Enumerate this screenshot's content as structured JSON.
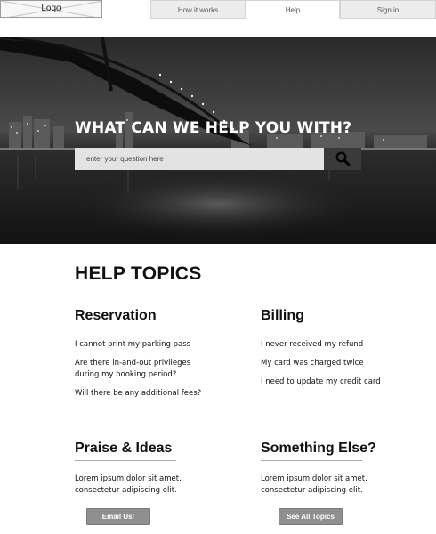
{
  "header": {
    "logo_text": "Logo",
    "nav": [
      {
        "label": "How it works"
      },
      {
        "label": "Help"
      },
      {
        "label": "Sign in"
      }
    ]
  },
  "hero": {
    "title": "WHAT CAN WE HELP YOU WITH?",
    "search_placeholder": "enter your question here",
    "search_icon": "magnifier-icon"
  },
  "help_topics": {
    "heading": "HELP TOPICS",
    "sections": [
      {
        "title": "Reservation",
        "links": [
          "I cannot print my parking pass",
          "Are there in-and-out privileges during my booking period?",
          "Will there be any additional fees?"
        ]
      },
      {
        "title": "Billing",
        "links": [
          "I never received my refund",
          "My card was charged twice",
          "I need to update my credit card"
        ]
      },
      {
        "title": "Praise & Ideas",
        "body": "Lorem ipsum dolor sit amet, consectetur adipiscing elit.",
        "button": "Email Us!"
      },
      {
        "title": "Something Else?",
        "body": "Lorem ipsum dolor sit amet, consectetur adipiscing elit.",
        "button": "See All Topics"
      }
    ]
  },
  "colors": {
    "nav_bg": "#ececec",
    "search_bg": "#e3e3e3",
    "search_button": "#3a3a3a",
    "cta_button": "#8f8f8f"
  }
}
